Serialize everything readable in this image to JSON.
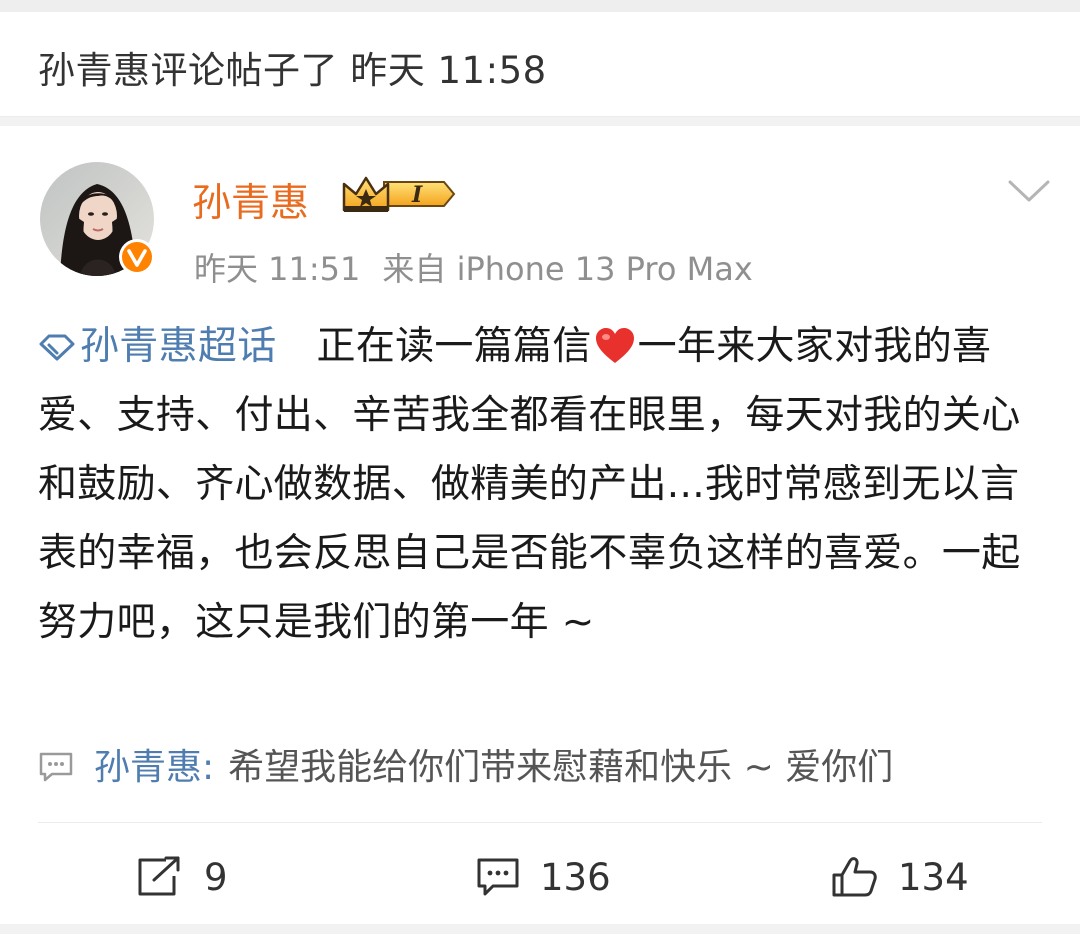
{
  "header": {
    "title": "孙青惠评论帖子了 昨天 11:58"
  },
  "post": {
    "author": "孙青惠",
    "time": "昨天 11:51",
    "source": "来自 iPhone 13 Pro Max",
    "topic": "孙青惠超话",
    "text_before_heart": "正在读一篇篇信",
    "text_after_heart": "一年来大家对我的喜爱、支持、付出、辛苦我全都看在眼里，每天对我的关心和鼓励、齐心做数据、做精美的产出...我时常感到无以言表的幸福，也会反思自己是否能不辜负这样的喜爱。一起努力吧，这只是我们的第一年 ~",
    "badge_level": "I"
  },
  "comment": {
    "user": "孙青惠",
    "colon": ":",
    "text": "希望我能给你们带来慰藉和快乐 ~ 爱你们"
  },
  "actions": {
    "reposts": "9",
    "comments": "136",
    "likes": "134"
  },
  "colors": {
    "username": "#e86b1f",
    "link": "#4f7db0",
    "meta": "#8f8f8f",
    "verified_badge": "#ff8200"
  },
  "icons": [
    "chevron-down-icon",
    "crown-badge-icon",
    "verified-badge-icon",
    "supertopic-icon",
    "heart-emoji-icon",
    "comment-bubble-icon",
    "repost-icon",
    "comment-icon",
    "like-icon"
  ]
}
